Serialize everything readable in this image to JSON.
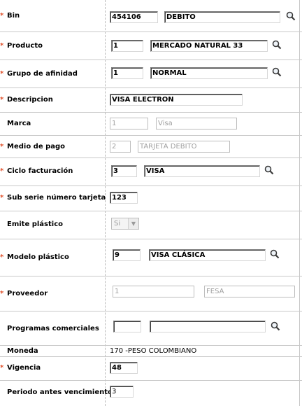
{
  "rows": {
    "bin": {
      "label": "Bin",
      "code": "454106",
      "desc": "DEBITO"
    },
    "producto": {
      "label": "Producto",
      "code": "1",
      "desc": "MERCADO NATURAL 33"
    },
    "grupo": {
      "label": "Grupo de afinidad",
      "code": "1",
      "desc": "NORMAL"
    },
    "descripcion": {
      "label": "Descripcion",
      "value": "VISA ELECTRON"
    },
    "marca": {
      "label": "Marca",
      "code": "1",
      "desc": "Visa"
    },
    "medio": {
      "label": "Medio de pago",
      "code": "2",
      "desc": "TARJETA DEBITO"
    },
    "ciclo": {
      "label": "Ciclo facturación",
      "code": "3",
      "desc": "VISA"
    },
    "subserie": {
      "label": "Sub serie número tarjeta",
      "value": "123"
    },
    "emite": {
      "label": "Emite plástico",
      "selected": "Si"
    },
    "modelo": {
      "label": "Modelo plástico",
      "code": "9",
      "desc": "VISA CLÁSICA"
    },
    "proveedor": {
      "label": "Proveedor",
      "code": "1",
      "desc": "FESA"
    },
    "programas": {
      "label": "Programas comerciales",
      "code": "",
      "desc": ""
    },
    "moneda": {
      "label": "Moneda",
      "value": "170 -PESO COLOMBIANO"
    },
    "vigencia": {
      "label": "Vigencia",
      "value": "48"
    },
    "periodo": {
      "label": "Periodo antes vencimiento",
      "value": "3"
    }
  },
  "required_mark": "*",
  "icons": {
    "lookup": "magnifier-icon",
    "dropdown": "chevron-down-icon"
  },
  "colors": {
    "required": "#e0502a",
    "divider": "#c9c9c9",
    "readonly_text": "#a0a0a0"
  }
}
